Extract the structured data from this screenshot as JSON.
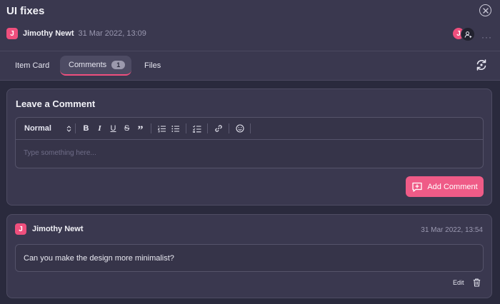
{
  "header": {
    "title": "UI fixes",
    "author_initial": "J",
    "author_name": "Jimothy Newt",
    "date": "31 Mar 2022, 13:09",
    "member_initial": "J",
    "more_label": "···"
  },
  "tabs": [
    {
      "label": "Item Card",
      "active": false
    },
    {
      "label": "Comments",
      "active": true,
      "badge": "1"
    },
    {
      "label": "Files",
      "active": false
    }
  ],
  "comment_form": {
    "heading": "Leave a Comment",
    "format_select": "Normal",
    "toolbar": {
      "bold": "B",
      "italic": "I",
      "underline": "U",
      "strike": "S",
      "quote": "”"
    },
    "placeholder": "Type something here...",
    "submit_label": "Add Comment"
  },
  "comments": [
    {
      "author_initial": "J",
      "author_name": "Jimothy Newt",
      "date": "31 Mar 2022, 13:54",
      "text": "Can you make the design more minimalist?",
      "edit_label": "Edit"
    }
  ],
  "colors": {
    "accent": "#ef5b87",
    "avatar": "#ef4f7d",
    "background": "#2a2a3d",
    "panel": "#3a384f"
  },
  "icons": {
    "close": "close-circle-icon",
    "refresh": "refresh-icon",
    "add_member": "add-user-icon",
    "add_comment": "comment-plus-icon",
    "delete": "trash-icon"
  }
}
